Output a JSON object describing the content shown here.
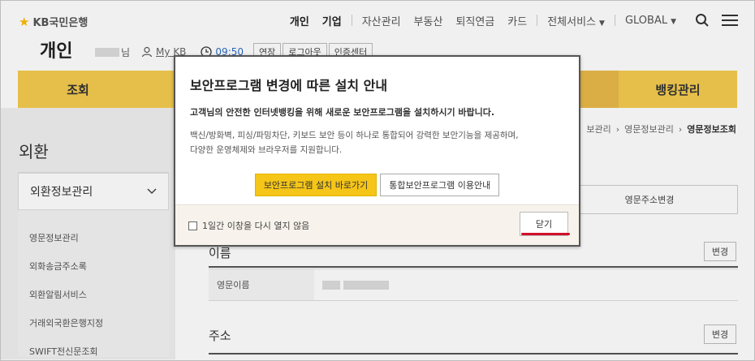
{
  "header": {
    "logo_text": "KB국민은행",
    "nav": [
      "개인",
      "기업",
      "자산관리",
      "부동산",
      "퇴직연금",
      "카드",
      "전체서비스",
      "GLOBAL"
    ],
    "section_title": "개인",
    "user_suffix": "님",
    "mykb": "My KB",
    "time": "09:50",
    "buttons": [
      "연장",
      "로그아웃",
      "인증센터"
    ]
  },
  "menubar": {
    "first": "조회",
    "last": "뱅킹관리"
  },
  "sidebar": {
    "title": "외환",
    "group": "외환정보관리",
    "items": [
      "영문정보관리",
      "외화송금주소록",
      "외환알림서비스",
      "거래외국환은행지정",
      "SWIFT전신문조회"
    ]
  },
  "content": {
    "breadcrumb": [
      "보관리",
      "영문정보관리",
      "영문정보조회"
    ],
    "tab": "영문주소변경",
    "section_name": "이름",
    "change_label": "변경",
    "row_label": "영문이름",
    "section_address": "주소"
  },
  "modal": {
    "title": "보안프로그램 변경에 따른 설치 안내",
    "para1": "고객님의 안전한 인터넷뱅킹을 위해 새로운 보안프로그램을 설치하시기 바랍니다.",
    "para2_line1": "백신/방화벽, 피싱/파밍차단, 키보드 보안 등이 하나로 통합되어 강력한 보안기능을 제공하며,",
    "para2_line2": "다양한 운영체제와 브라우저를 지원합니다.",
    "install_button": "보안프로그램 설치 바로가기",
    "guide_button": "통합보안프로그램 이용안내",
    "checkbox_label": "1일간 이창을 다시 열지 않음",
    "close_button": "닫기"
  },
  "colors": {
    "accent": "#f5cb4f",
    "install_button": "#f5c518",
    "highlight_line": "#d4102a"
  }
}
